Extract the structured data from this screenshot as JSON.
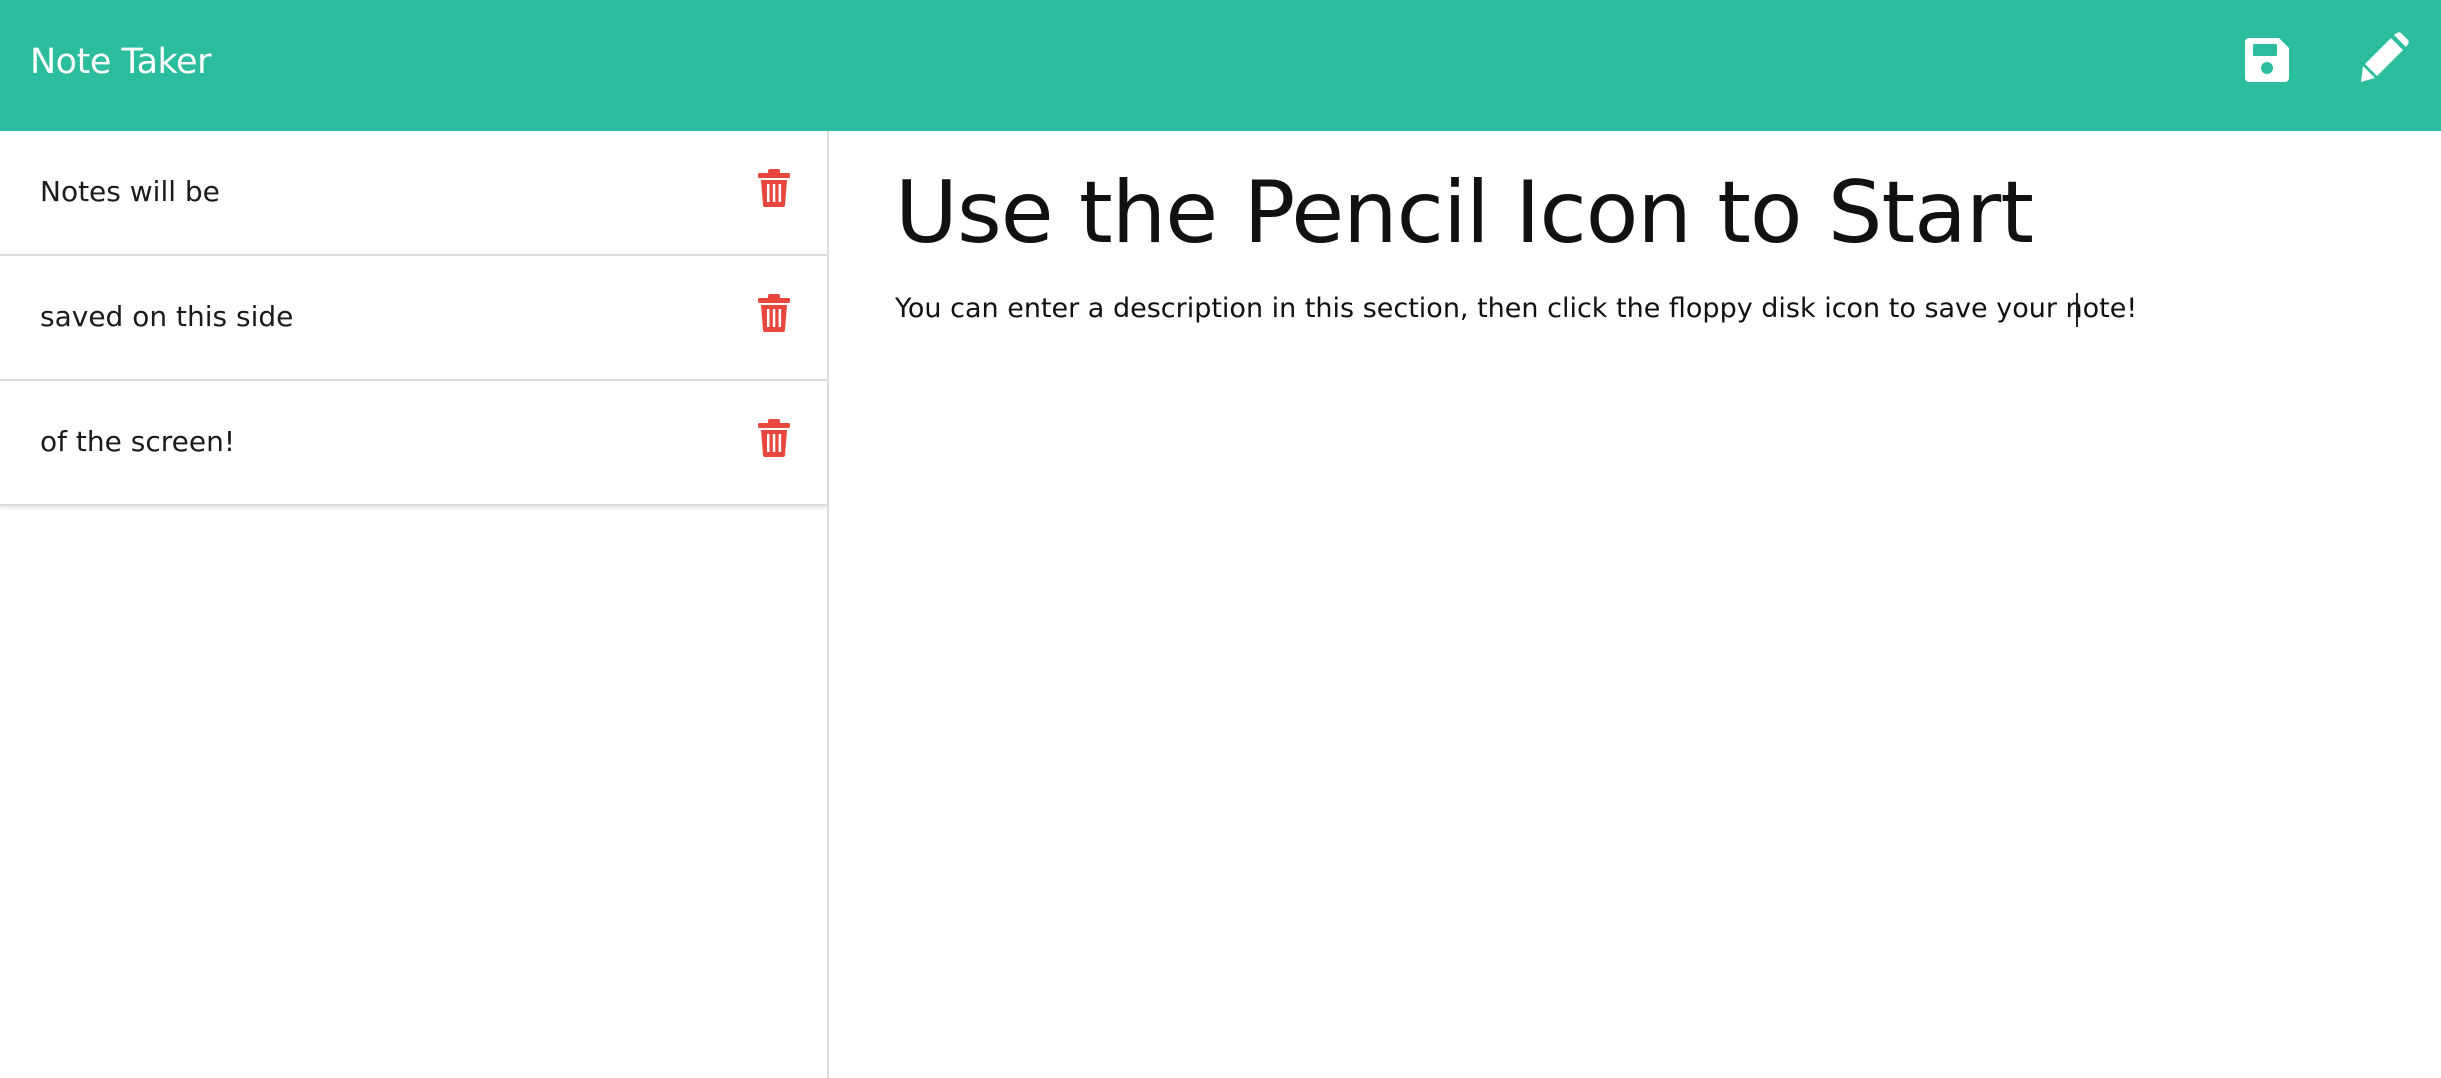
{
  "navbar": {
    "brand": "Note Taker",
    "background_color": "#2bbd9d",
    "icons": [
      "save-icon",
      "pencil-icon"
    ]
  },
  "sidebar": {
    "notes": [
      {
        "title": "Notes will be"
      },
      {
        "title": "saved on this side"
      },
      {
        "title": "of the screen!"
      }
    ],
    "delete_icon": "trash-icon",
    "delete_color": "#e8473e"
  },
  "editor": {
    "title_placeholder": "Use the Pencil Icon to Start",
    "text_placeholder": "You can enter a description in this section, then click the floppy disk icon to save your note!"
  }
}
